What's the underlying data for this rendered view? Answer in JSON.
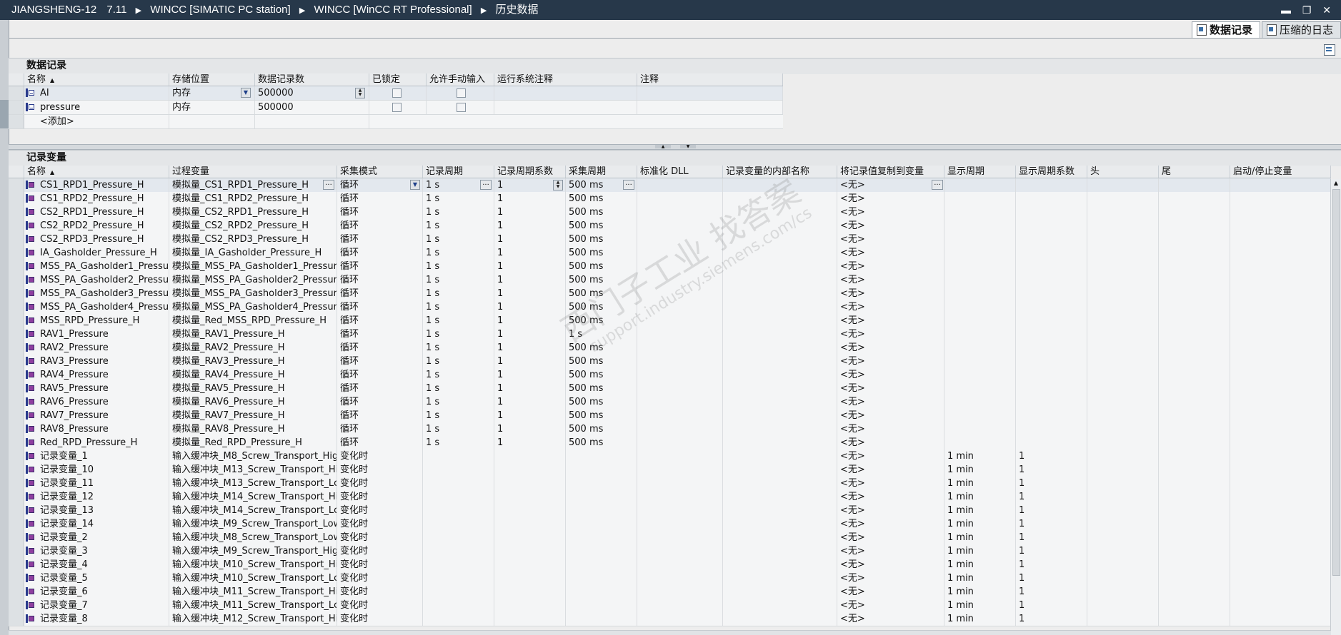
{
  "titlebar": {
    "crumbs": [
      "JIANGSHENG-12",
      "7.11",
      "WINCC [SIMATIC PC station]",
      "WINCC [WinCC RT Professional]",
      "历史数据"
    ],
    "window_buttons": "▬ ❐ ✕"
  },
  "tabs": [
    {
      "label": "数据记录",
      "active": true
    },
    {
      "label": "压缩的日志",
      "active": false
    }
  ],
  "data_logs": {
    "title": "数据记录",
    "columns": [
      "名称",
      "存储位置",
      "数据记录数",
      "已锁定",
      "允许手动输入",
      "运行系统注释",
      "注释"
    ],
    "rows": [
      {
        "name": "AI",
        "storage": "内存",
        "count": "500000"
      },
      {
        "name": "pressure",
        "storage": "内存",
        "count": "500000"
      }
    ],
    "add_label": "<添加>"
  },
  "log_tags": {
    "title": "记录变量",
    "columns": [
      "名称",
      "过程变量",
      "采集模式",
      "记录周期",
      "记录周期系数",
      "采集周期",
      "标准化 DLL",
      "记录变量的内部名称",
      "将记录值复制到变量",
      "显示周期",
      "显示周期系数",
      "头",
      "尾",
      "启动/停止变量"
    ],
    "rows": [
      {
        "name": "CS1_RPD1_Pressure_H",
        "tag": "模拟量_CS1_RPD1_Pressure_H",
        "mode": "循环",
        "cycle": "1 s",
        "factor": "1",
        "acq": "500 ms",
        "copy": "<无>",
        "disp": "",
        "dispf": ""
      },
      {
        "name": "CS1_RPD2_Pressure_H",
        "tag": "模拟量_CS1_RPD2_Pressure_H",
        "mode": "循环",
        "cycle": "1 s",
        "factor": "1",
        "acq": "500 ms",
        "copy": "<无>",
        "disp": "",
        "dispf": ""
      },
      {
        "name": "CS2_RPD1_Pressure_H",
        "tag": "模拟量_CS2_RPD1_Pressure_H",
        "mode": "循环",
        "cycle": "1 s",
        "factor": "1",
        "acq": "500 ms",
        "copy": "<无>",
        "disp": "",
        "dispf": ""
      },
      {
        "name": "CS2_RPD2_Pressure_H",
        "tag": "模拟量_CS2_RPD2_Pressure_H",
        "mode": "循环",
        "cycle": "1 s",
        "factor": "1",
        "acq": "500 ms",
        "copy": "<无>",
        "disp": "",
        "dispf": ""
      },
      {
        "name": "CS2_RPD3_Pressure_H",
        "tag": "模拟量_CS2_RPD3_Pressure_H",
        "mode": "循环",
        "cycle": "1 s",
        "factor": "1",
        "acq": "500 ms",
        "copy": "<无>",
        "disp": "",
        "dispf": ""
      },
      {
        "name": "IA_Gasholder_Pressure_H",
        "tag": "模拟量_IA_Gasholder_Pressure_H",
        "mode": "循环",
        "cycle": "1 s",
        "factor": "1",
        "acq": "500 ms",
        "copy": "<无>",
        "disp": "",
        "dispf": ""
      },
      {
        "name": "MSS_PA_Gasholder1_Pressure_",
        "tag": "模拟量_MSS_PA_Gasholder1_Pressure_",
        "mode": "循环",
        "cycle": "1 s",
        "factor": "1",
        "acq": "500 ms",
        "copy": "<无>",
        "disp": "",
        "dispf": ""
      },
      {
        "name": "MSS_PA_Gasholder2_Pressure_",
        "tag": "模拟量_MSS_PA_Gasholder2_Pressure_",
        "mode": "循环",
        "cycle": "1 s",
        "factor": "1",
        "acq": "500 ms",
        "copy": "<无>",
        "disp": "",
        "dispf": ""
      },
      {
        "name": "MSS_PA_Gasholder3_Pressure_",
        "tag": "模拟量_MSS_PA_Gasholder3_Pressure_",
        "mode": "循环",
        "cycle": "1 s",
        "factor": "1",
        "acq": "500 ms",
        "copy": "<无>",
        "disp": "",
        "dispf": ""
      },
      {
        "name": "MSS_PA_Gasholder4_Pressure_",
        "tag": "模拟量_MSS_PA_Gasholder4_Pressure_",
        "mode": "循环",
        "cycle": "1 s",
        "factor": "1",
        "acq": "500 ms",
        "copy": "<无>",
        "disp": "",
        "dispf": ""
      },
      {
        "name": "MSS_RPD_Pressure_H",
        "tag": "模拟量_Red_MSS_RPD_Pressure_H",
        "mode": "循环",
        "cycle": "1 s",
        "factor": "1",
        "acq": "500 ms",
        "copy": "<无>",
        "disp": "",
        "dispf": ""
      },
      {
        "name": "RAV1_Pressure",
        "tag": "模拟量_RAV1_Pressure_H",
        "mode": "循环",
        "cycle": "1 s",
        "factor": "1",
        "acq": "1 s",
        "copy": "<无>",
        "disp": "",
        "dispf": ""
      },
      {
        "name": "RAV2_Pressure",
        "tag": "模拟量_RAV2_Pressure_H",
        "mode": "循环",
        "cycle": "1 s",
        "factor": "1",
        "acq": "500 ms",
        "copy": "<无>",
        "disp": "",
        "dispf": ""
      },
      {
        "name": "RAV3_Pressure",
        "tag": "模拟量_RAV3_Pressure_H",
        "mode": "循环",
        "cycle": "1 s",
        "factor": "1",
        "acq": "500 ms",
        "copy": "<无>",
        "disp": "",
        "dispf": ""
      },
      {
        "name": "RAV4_Pressure",
        "tag": "模拟量_RAV4_Pressure_H",
        "mode": "循环",
        "cycle": "1 s",
        "factor": "1",
        "acq": "500 ms",
        "copy": "<无>",
        "disp": "",
        "dispf": ""
      },
      {
        "name": "RAV5_Pressure",
        "tag": "模拟量_RAV5_Pressure_H",
        "mode": "循环",
        "cycle": "1 s",
        "factor": "1",
        "acq": "500 ms",
        "copy": "<无>",
        "disp": "",
        "dispf": ""
      },
      {
        "name": "RAV6_Pressure",
        "tag": "模拟量_RAV6_Pressure_H",
        "mode": "循环",
        "cycle": "1 s",
        "factor": "1",
        "acq": "500 ms",
        "copy": "<无>",
        "disp": "",
        "dispf": ""
      },
      {
        "name": "RAV7_Pressure",
        "tag": "模拟量_RAV7_Pressure_H",
        "mode": "循环",
        "cycle": "1 s",
        "factor": "1",
        "acq": "500 ms",
        "copy": "<无>",
        "disp": "",
        "dispf": ""
      },
      {
        "name": "RAV8_Pressure",
        "tag": "模拟量_RAV8_Pressure_H",
        "mode": "循环",
        "cycle": "1 s",
        "factor": "1",
        "acq": "500 ms",
        "copy": "<无>",
        "disp": "",
        "dispf": ""
      },
      {
        "name": "Red_RPD_Pressure_H",
        "tag": "模拟量_Red_RPD_Pressure_H",
        "mode": "循环",
        "cycle": "1 s",
        "factor": "1",
        "acq": "500 ms",
        "copy": "<无>",
        "disp": "",
        "dispf": ""
      },
      {
        "name": "记录变量_1",
        "tag": "输入缓冲块_M8_Screw_Transport_Hig",
        "mode": "变化时",
        "cycle": "",
        "factor": "",
        "acq": "",
        "copy": "<无>",
        "disp": "1 min",
        "dispf": "1"
      },
      {
        "name": "记录变量_10",
        "tag": "输入缓冲块_M13_Screw_Transport_Hi",
        "mode": "变化时",
        "cycle": "",
        "factor": "",
        "acq": "",
        "copy": "<无>",
        "disp": "1 min",
        "dispf": "1"
      },
      {
        "name": "记录变量_11",
        "tag": "输入缓冲块_M13_Screw_Transport_Lc",
        "mode": "变化时",
        "cycle": "",
        "factor": "",
        "acq": "",
        "copy": "<无>",
        "disp": "1 min",
        "dispf": "1"
      },
      {
        "name": "记录变量_12",
        "tag": "输入缓冲块_M14_Screw_Transport_Hi",
        "mode": "变化时",
        "cycle": "",
        "factor": "",
        "acq": "",
        "copy": "<无>",
        "disp": "1 min",
        "dispf": "1"
      },
      {
        "name": "记录变量_13",
        "tag": "输入缓冲块_M14_Screw_Transport_Lc",
        "mode": "变化时",
        "cycle": "",
        "factor": "",
        "acq": "",
        "copy": "<无>",
        "disp": "1 min",
        "dispf": "1"
      },
      {
        "name": "记录变量_14",
        "tag": "输入缓冲块_M9_Screw_Transport_Low",
        "mode": "变化时",
        "cycle": "",
        "factor": "",
        "acq": "",
        "copy": "<无>",
        "disp": "1 min",
        "dispf": "1"
      },
      {
        "name": "记录变量_2",
        "tag": "输入缓冲块_M8_Screw_Transport_Low",
        "mode": "变化时",
        "cycle": "",
        "factor": "",
        "acq": "",
        "copy": "<无>",
        "disp": "1 min",
        "dispf": "1"
      },
      {
        "name": "记录变量_3",
        "tag": "输入缓冲块_M9_Screw_Transport_Hig",
        "mode": "变化时",
        "cycle": "",
        "factor": "",
        "acq": "",
        "copy": "<无>",
        "disp": "1 min",
        "dispf": "1"
      },
      {
        "name": "记录变量_4",
        "tag": "输入缓冲块_M10_Screw_Transport_Hi",
        "mode": "变化时",
        "cycle": "",
        "factor": "",
        "acq": "",
        "copy": "<无>",
        "disp": "1 min",
        "dispf": "1"
      },
      {
        "name": "记录变量_5",
        "tag": "输入缓冲块_M10_Screw_Transport_Lc",
        "mode": "变化时",
        "cycle": "",
        "factor": "",
        "acq": "",
        "copy": "<无>",
        "disp": "1 min",
        "dispf": "1"
      },
      {
        "name": "记录变量_6",
        "tag": "输入缓冲块_M11_Screw_Transport_Hi",
        "mode": "变化时",
        "cycle": "",
        "factor": "",
        "acq": "",
        "copy": "<无>",
        "disp": "1 min",
        "dispf": "1"
      },
      {
        "name": "记录变量_7",
        "tag": "输入缓冲块_M11_Screw_Transport_Lc",
        "mode": "变化时",
        "cycle": "",
        "factor": "",
        "acq": "",
        "copy": "<无>",
        "disp": "1 min",
        "dispf": "1"
      },
      {
        "name": "记录变量_8",
        "tag": "输入缓冲块_M12_Screw_Transport_Hi",
        "mode": "变化时",
        "cycle": "",
        "factor": "",
        "acq": "",
        "copy": "<无>",
        "disp": "1 min",
        "dispf": "1"
      }
    ]
  },
  "watermark": {
    "line1": "西门子工业 找答案",
    "line2": "support.industry.siemens.com/cs"
  }
}
